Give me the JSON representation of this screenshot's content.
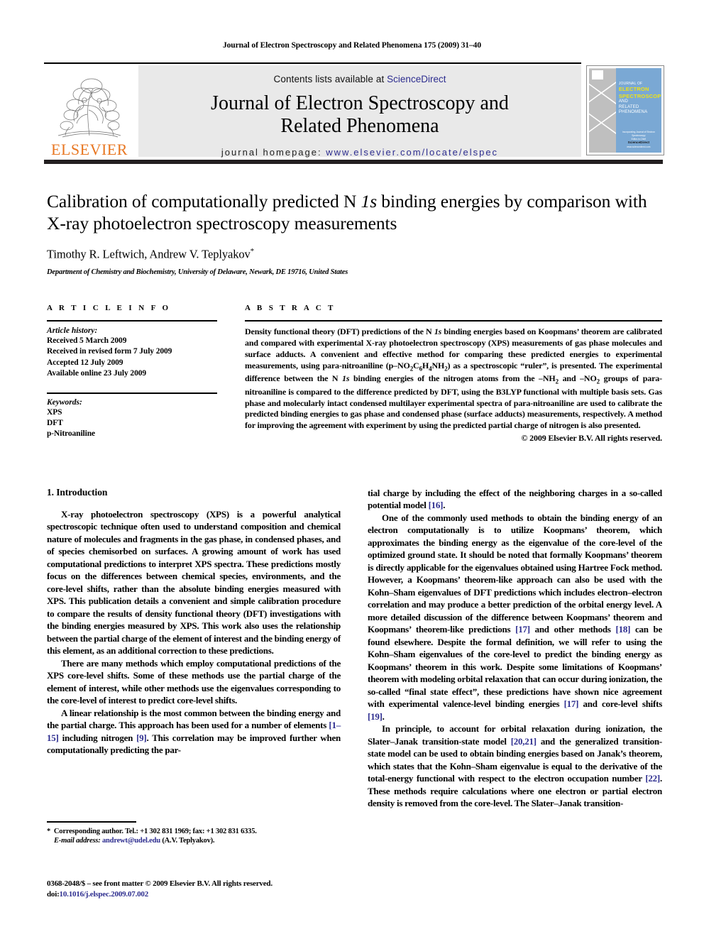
{
  "running_head": "Journal of Electron Spectroscopy and Related Phenomena 175 (2009) 31–40",
  "masthead": {
    "publisher_name": "ELSEVIER",
    "contents_prefix": "Contents lists available at ",
    "contents_link": "ScienceDirect",
    "journal_title_line1": "Journal of Electron Spectroscopy and",
    "journal_title_line2": "Related Phenomena",
    "homepage_label": "journal homepage:",
    "homepage_url": "www.elsevier.com/locate/elspec",
    "cover": {
      "line_top": "JOURNAL OF",
      "line_1": "ELECTRON",
      "line_2": "SPECTROSCOPY",
      "line_3": "AND",
      "line_4": "RELATED PHENOMENA",
      "foot_1": "Incorporating Journal of Electron Spectroscopy",
      "foot_2": "Editor-in-Chief",
      "foot_brand": "ScienceDirect",
      "foot_url": "www.sciencedirect.com"
    }
  },
  "article": {
    "title_part1": "Calibration of computationally predicted N ",
    "title_italic": "1s",
    "title_part2": " binding energies by comparison with X-ray photoelectron spectroscopy measurements",
    "authors": "Timothy R. Leftwich, Andrew V. Teplyakov",
    "corresponding_marker": "*",
    "affiliation": "Department of Chemistry and Biochemistry, University of Delaware, Newark, DE 19716, United States"
  },
  "article_info": {
    "heading": "A R T I C L E   I N F O",
    "history_label": "Article history:",
    "history": [
      "Received 5 March 2009",
      "Received in revised form 7 July 2009",
      "Accepted 12 July 2009",
      "Available online 23 July 2009"
    ],
    "keywords_label": "Keywords:",
    "keywords": [
      "XPS",
      "DFT",
      "p-Nitroaniline"
    ]
  },
  "abstract": {
    "heading": "A B S T R A C T",
    "paragraph_a": "Density functional theory (DFT) predictions of the N ",
    "paragraph_b": "1s",
    "paragraph_c": " binding energies based on Koopmans’ theorem are calibrated and compared with experimental X-ray photoelectron spectroscopy (XPS) measurements of gas phase molecules and surface adducts. A convenient and effective method for comparing these predicted energies to experimental measurements, using para-nitroaniline (p–NO",
    "sub_2a": "2",
    "paragraph_d": "C",
    "sub_6": "6",
    "paragraph_e": "H",
    "sub_4": "4",
    "paragraph_f": "NH",
    "sub_2b": "2",
    "paragraph_g": ") as a spectroscopic “ruler”, is presented. The experimental difference between the N ",
    "paragraph_h": "1s",
    "paragraph_i": " binding energies of the nitrogen atoms from the –NH",
    "sub_2c": "2",
    "paragraph_j": " and –NO",
    "sub_2d": "2",
    "paragraph_k": " groups of para-nitroaniline is compared to the difference predicted by DFT, using the B3LYP functional with multiple basis sets. Gas phase and molecularly intact condensed multilayer experimental spectra of para-nitroaniline are used to calibrate the predicted binding energies to gas phase and condensed phase (surface adducts) measurements, respectively. A method for improving the agreement with experiment by using the predicted partial charge of nitrogen is also presented.",
    "copyright": "© 2009 Elsevier B.V. All rights reserved."
  },
  "body": {
    "section_heading": "1.  Introduction",
    "left_paragraphs": [
      "X-ray photoelectron spectroscopy (XPS) is a powerful analytical spectroscopic technique often used to understand composition and chemical nature of molecules and fragments in the gas phase, in condensed phases, and of species chemisorbed on surfaces. A growing amount of work has used computational predictions to interpret XPS spectra. These predictions mostly focus on the differences between chemical species, environments, and the core-level shifts, rather than the absolute binding energies measured with XPS. This publication details a convenient and simple calibration procedure to compare the results of density functional theory (DFT) investigations with the binding energies measured by XPS. This work also uses the relationship between the partial charge of the element of interest and the binding energy of this element, as an additional correction to these predictions.",
      "There are many methods which employ computational predictions of the XPS core-level shifts. Some of these methods use the partial charge of the element of interest, while other methods use the eigenvalues corresponding to the core-level of interest to predict core-level shifts."
    ],
    "left_paragraph_3_a": "A linear relationship is the most common between the binding energy and the partial charge. This approach has been used for a number of elements ",
    "left_paragraph_3_ref1": "[1–15]",
    "left_paragraph_3_b": " including nitrogen ",
    "left_paragraph_3_ref2": "[9]",
    "left_paragraph_3_c": ". This correlation may be improved further when computationally predicting the par-",
    "right_paragraph_1_a": "tial charge by including the effect of the neighboring charges in a so-called potential model ",
    "right_paragraph_1_ref": "[16]",
    "right_paragraph_1_b": ".",
    "right_paragraph_2_a": "One of the commonly used methods to obtain the binding energy of an electron computationally is to utilize Koopmans’ theorem, which approximates the binding energy as the eigenvalue of the core-level of the optimized ground state. It should be noted that formally Koopmans’ theorem is directly applicable for the eigenvalues obtained using Hartree Fock method. However, a Koopmans’ theorem-like approach can also be used with the Kohn–Sham eigenvalues of DFT predictions which includes electron–electron correlation and may produce a better prediction of the orbital energy level. A more detailed discussion of the difference between Koopmans’ theorem and Koopmans’ theorem-like predictions ",
    "right_paragraph_2_ref1": "[17]",
    "right_paragraph_2_b": " and other methods ",
    "right_paragraph_2_ref2": "[18]",
    "right_paragraph_2_c": " can be found elsewhere. Despite the formal definition, we will refer to using the Kohn–Sham eigenvalues of the core-level to predict the binding energy as Koopmans’ theorem in this work. Despite some limitations of Koopmans’ theorem with modeling orbital relaxation that can occur during ionization, the so-called “final state effect”, these predictions have shown nice agreement with experimental valence-level binding energies ",
    "right_paragraph_2_ref3": "[17]",
    "right_paragraph_2_d": " and core-level shifts ",
    "right_paragraph_2_ref4": "[19]",
    "right_paragraph_2_e": ".",
    "right_paragraph_3_a": "In principle, to account for orbital relaxation during ionization, the Slater–Janak transition-state model ",
    "right_paragraph_3_ref1": "[20,21]",
    "right_paragraph_3_b": " and the generalized transition-state model can be used to obtain binding energies based on Janak’s theorem, which states that the Kohn–Sham eigenvalue is equal to the derivative of the total-energy functional with respect to the electron occupation number ",
    "right_paragraph_3_ref2": "[22]",
    "right_paragraph_3_c": ". These methods require calculations where one electron or partial electron density is removed from the core-level. The Slater–Janak transition-"
  },
  "footer": {
    "corr_marker": "*",
    "corr_text": "Corresponding author. Tel.: +1 302 831 1969; fax: +1 302 831 6335.",
    "email_label": "E-mail address:",
    "email": "andrewt@udel.edu",
    "email_suffix": " (A.V. Teplyakov).",
    "issn_line": "0368-2048/$ – see front matter © 2009 Elsevier B.V. All rights reserved.",
    "doi_label": "doi:",
    "doi_value": "10.1016/j.elspec.2009.07.002"
  },
  "colors": {
    "link_blue": "#2d2d8f",
    "elsevier_orange": "#E87722",
    "panel_gray": "#e9e9e9",
    "rule_dark": "#231f20",
    "cover_blue": "#7aa8d4",
    "cover_yellow": "#f2e313"
  }
}
